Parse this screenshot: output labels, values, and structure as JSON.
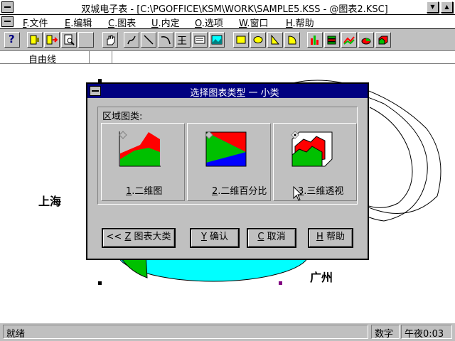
{
  "window": {
    "title": "双城电子表 - [C:\\PGOFFICE\\KSM\\WORK\\SAMPLE5.KSS - @图表2.KSC]",
    "minimize_glyph": "▼",
    "maximize_glyph": "▲"
  },
  "menubar": {
    "items": [
      {
        "key": "F",
        "label": ".文件"
      },
      {
        "key": "E",
        "label": ".编辑"
      },
      {
        "key": "C",
        "label": ".图表"
      },
      {
        "key": "U",
        "label": ".内定"
      },
      {
        "key": "O",
        "label": ".选项"
      },
      {
        "key": "W",
        "label": ".窗口"
      },
      {
        "key": "H",
        "label": ".帮助"
      }
    ]
  },
  "toolbar": {
    "help_glyph": "?",
    "table_glyph": "王",
    "icons": [
      "help-icon",
      "insert-icon",
      "move-icon",
      "preview-icon",
      "blank-icon",
      "hand-icon",
      "freehand-icon",
      "line-icon",
      "arc-icon",
      "table-icon",
      "text-box-icon",
      "picture-icon",
      "rectangle-icon",
      "ellipse-icon",
      "triangle-icon",
      "pie-shape-icon",
      "bar-chart-icon",
      "3d-bar-icon",
      "line-chart-icon",
      "pie-chart-icon",
      "3d-area-icon"
    ]
  },
  "sheet": {
    "cell_label": "自由线",
    "label_shanghai": "上海",
    "label_guangzhou": "广州"
  },
  "dialog": {
    "title": "选择图表类型 一 小类",
    "group_label": "区域图类:",
    "options": [
      {
        "key": "1",
        "label": ".二维图",
        "selected": false
      },
      {
        "key": "2",
        "label": ".二维百分比",
        "selected": false
      },
      {
        "key": "3",
        "label": ".三维透视",
        "selected": true
      }
    ],
    "buttons": {
      "back": {
        "prefix": "<<",
        "key": "Z",
        "label": " 图表大类"
      },
      "ok": {
        "key": "Y",
        "label": " 确认"
      },
      "cancel": {
        "key": "C",
        "label": " 取消"
      },
      "help": {
        "key": "H",
        "label": " 帮助"
      }
    }
  },
  "statusbar": {
    "status": "就绪",
    "mode": "数字",
    "time": "午夜0:03"
  },
  "colors": {
    "dialog_title": "#000080",
    "chart_red": "#ff0000",
    "chart_green": "#00c000",
    "chart_blue": "#0000ff",
    "chart_cyan": "#00ffff"
  }
}
